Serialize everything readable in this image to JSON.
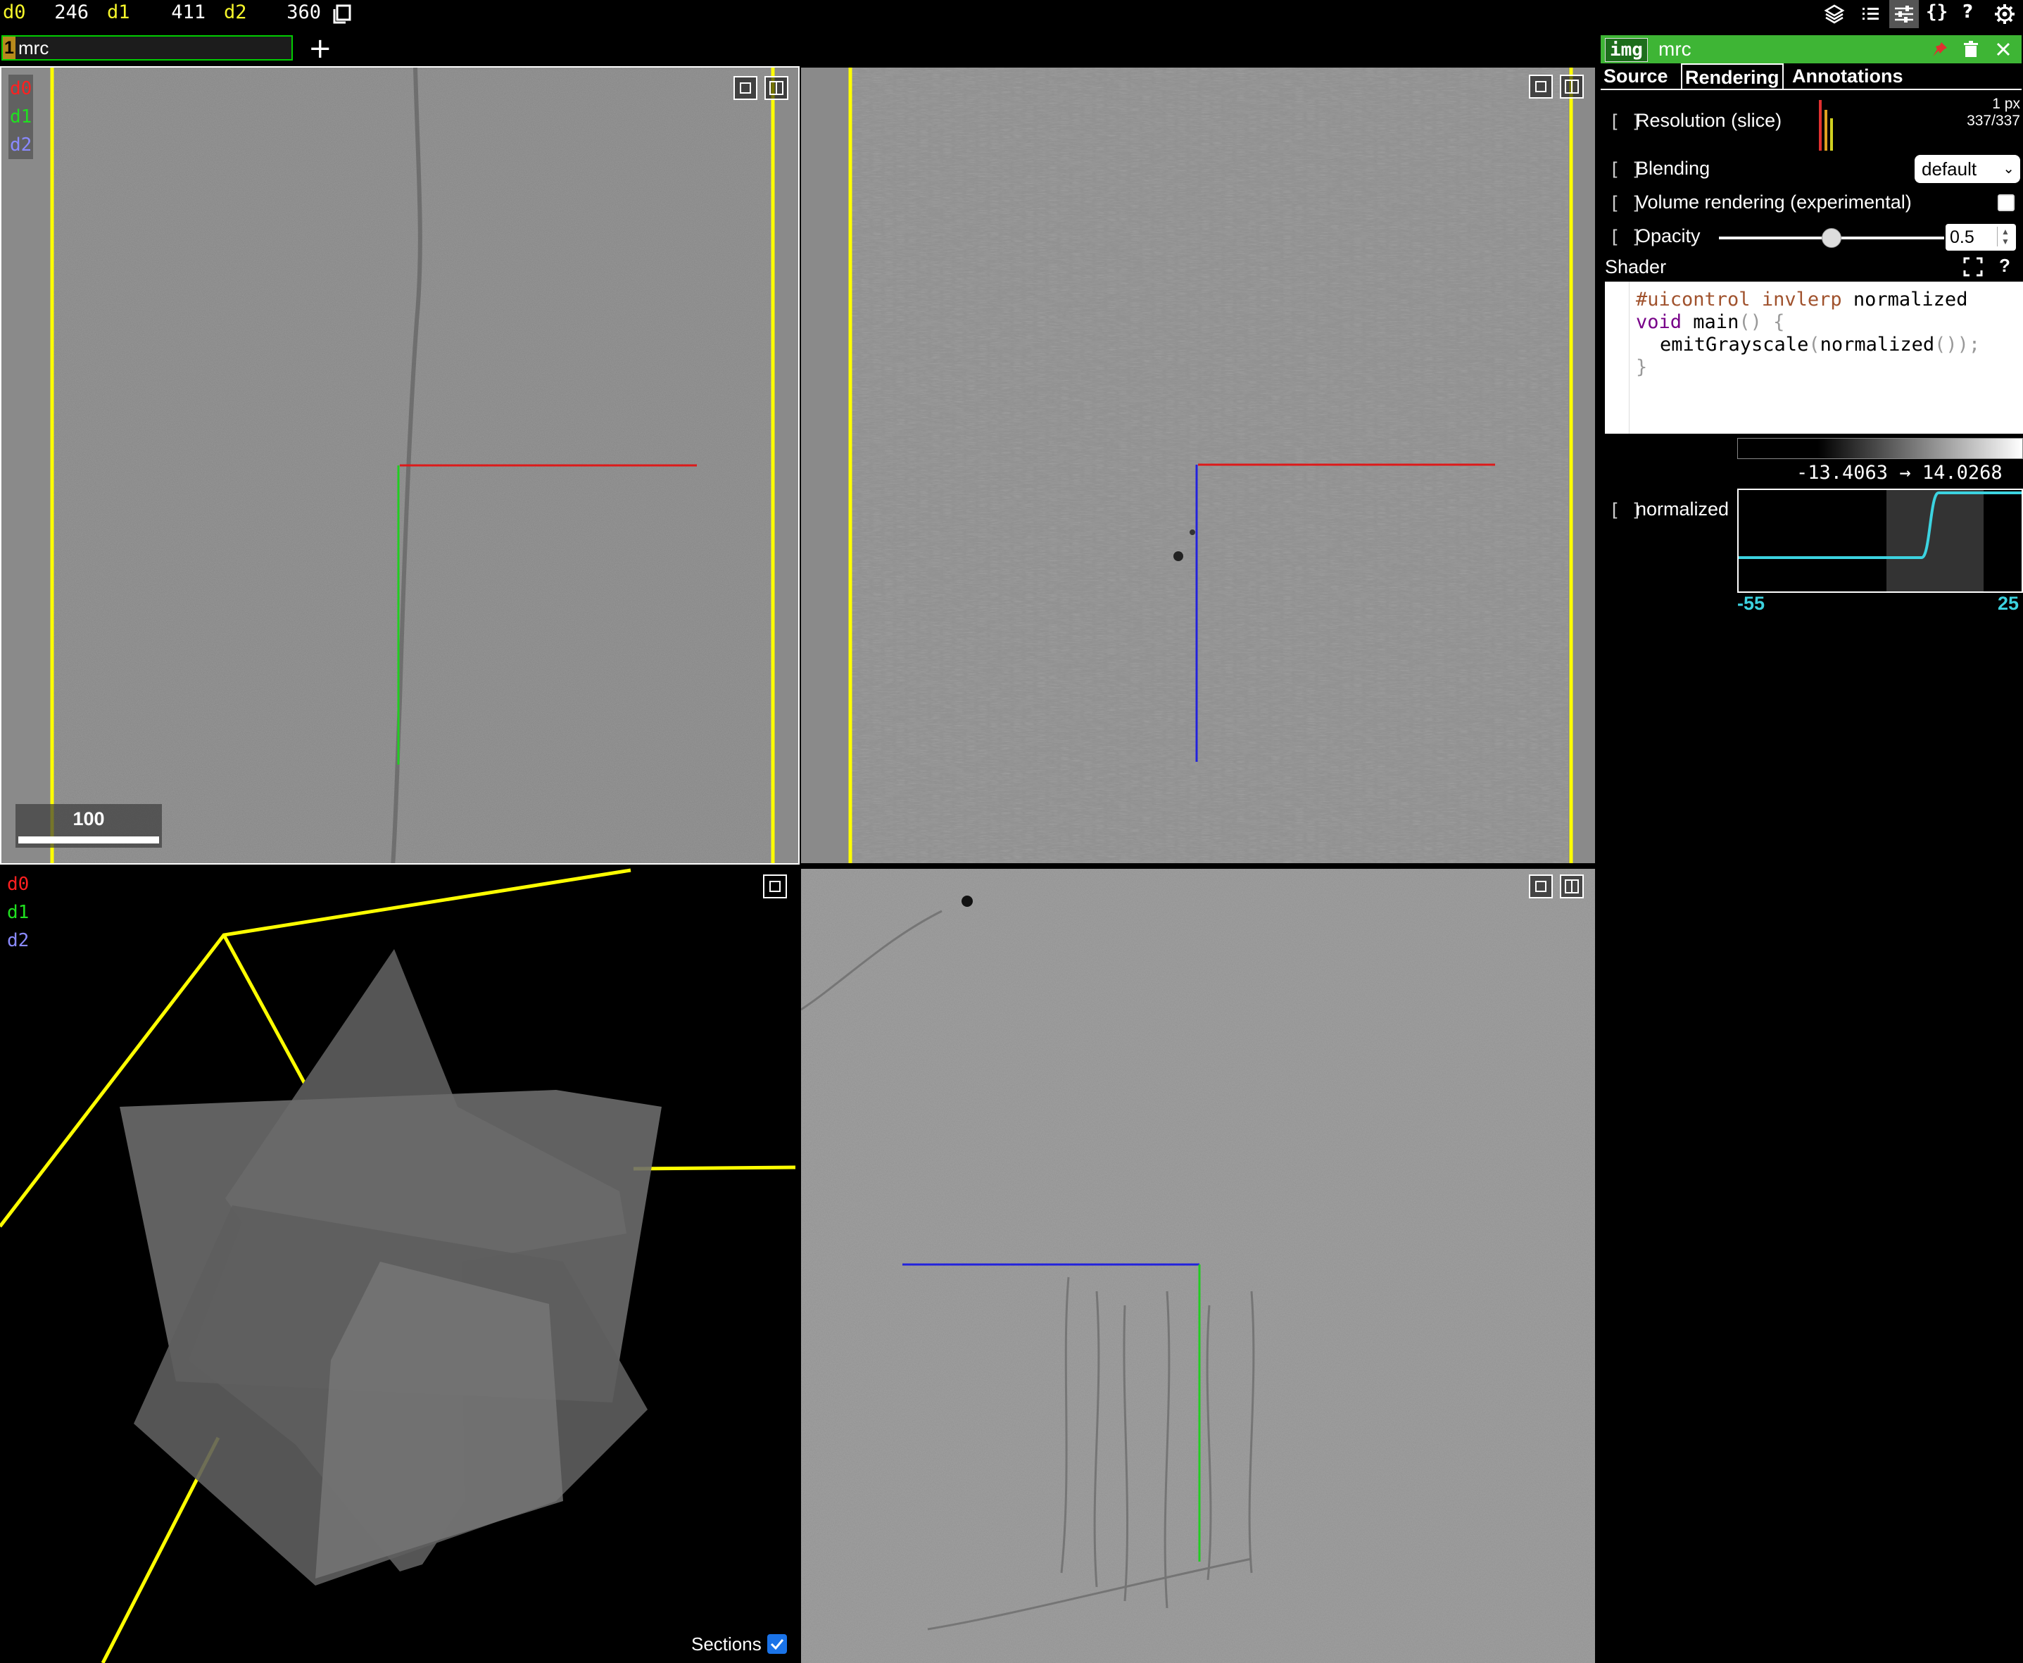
{
  "position": {
    "dims": [
      {
        "name": "d0",
        "value": "246"
      },
      {
        "name": "d1",
        "value": "411"
      },
      {
        "name": "d2",
        "value": "360"
      }
    ]
  },
  "layer_tab": {
    "number": "1",
    "name": "mrc",
    "add_label": "+"
  },
  "panels": {
    "axis_labels": [
      "d0",
      "d1",
      "d2"
    ],
    "axis_colors": {
      "d0": "#ff2020",
      "d1": "#20e020",
      "d2": "#8a8aff"
    },
    "scalebar_label": "100",
    "sections_label": "Sections",
    "sections_checked": true
  },
  "side_panel": {
    "layer_type": "img",
    "layer_name": "mrc",
    "tabs": [
      "Source",
      "Rendering",
      "Annotations"
    ],
    "active_tab": "Rendering",
    "resolution_label": "Resolution (slice)",
    "resolution_px": "1 px",
    "resolution_fraction": "337/337",
    "blending_label": "Blending",
    "blending_value": "default",
    "volume_label": "Volume rendering (experimental)",
    "volume_checked": false,
    "opacity_label": "Opacity",
    "opacity_value": "0.5",
    "shader_label": "Shader",
    "shader_help": "?",
    "shader_code": {
      "line1_directive": "#uicontrol",
      "line1_type": "invlerp",
      "line1_name": "normalized",
      "line2_type": "void",
      "line2_fn": "main",
      "line2_rest": "() {",
      "line3_call": "emitGrayscale",
      "line3_arg": "normalized",
      "line3_rest": "());",
      "line4": "}"
    },
    "range_min": "-13.4063",
    "range_arrow": "→",
    "range_max": "14.0268",
    "normalized_label": "normalized",
    "normalized_min": "-55",
    "normalized_max": "25",
    "bracket": "[ ]",
    "accent_green": "#3eb535",
    "cyan": "#3cd3e0"
  },
  "icons": [
    "copy-icon",
    "layers-icon",
    "list-icon",
    "sliders-icon",
    "braces-icon",
    "help-icon",
    "settings-icon",
    "pin-icon",
    "trash-icon",
    "close-icon",
    "maximize-panel-icon",
    "split-panel-icon",
    "expand-icon"
  ]
}
